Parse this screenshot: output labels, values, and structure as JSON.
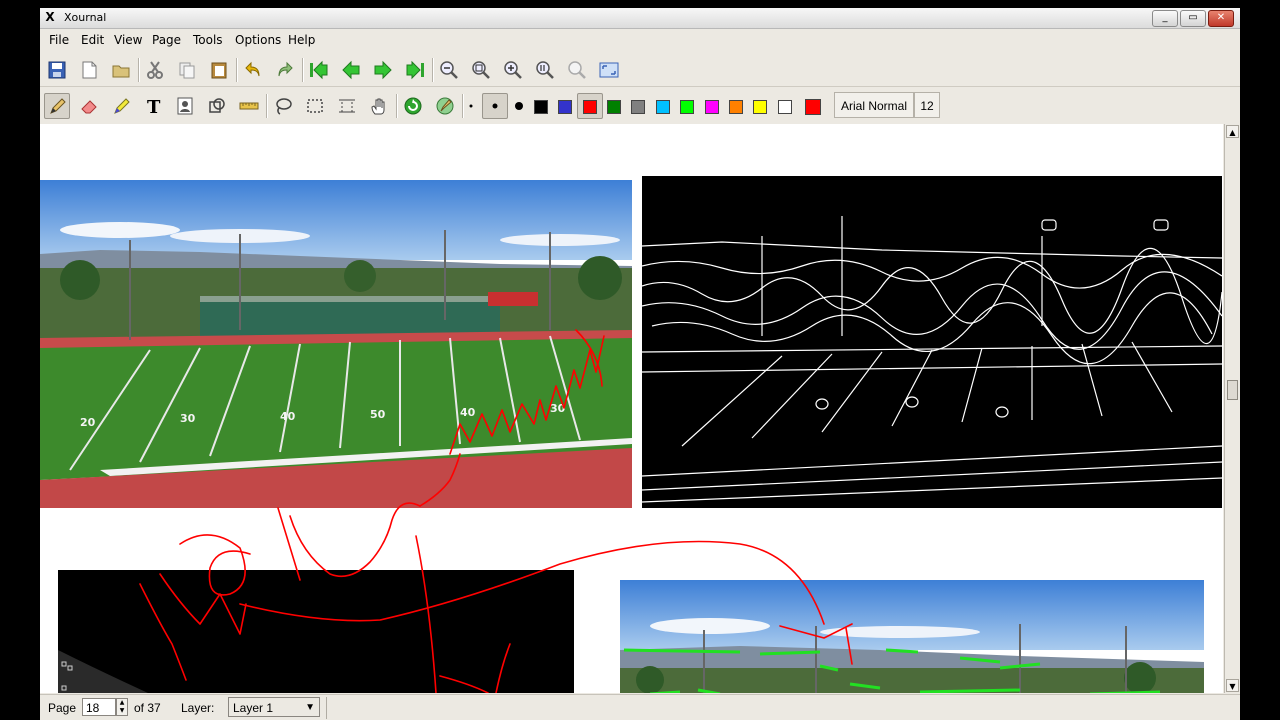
{
  "window": {
    "title": "Xournal",
    "minimize": "_",
    "maximize": "▭",
    "close": "✕"
  },
  "menu": [
    {
      "label": "File"
    },
    {
      "label": "Edit"
    },
    {
      "label": "View"
    },
    {
      "label": "Page"
    },
    {
      "label": "Tools"
    },
    {
      "label": "Options"
    },
    {
      "label": "Help"
    }
  ],
  "toolbar_main": [
    "save-icon",
    "new-page-icon",
    "open-icon",
    "cut-icon",
    "copy-icon",
    "paste-icon",
    "undo-icon",
    "redo-icon",
    "first-page-icon",
    "previous-page-icon",
    "next-page-icon",
    "last-page-icon",
    "zoom-out-icon",
    "zoom-fit-icon",
    "zoom-in-icon",
    "zoom-100-icon",
    "zoom-set-icon",
    "fullscreen-icon"
  ],
  "toolbar_tools": {
    "active_tool": "pen",
    "active_thickness": "medium",
    "active_color": "#ff0000",
    "colors": [
      "#000000",
      "#3333cc",
      "#ff0000",
      "#008000",
      "#808080",
      "#00c0ff",
      "#00ff00",
      "#ff00ff",
      "#ff8000",
      "#ffff00",
      "#ffffff"
    ],
    "current_color": "#ff0000",
    "font_name": "Arial Normal",
    "font_size": "12"
  },
  "statusbar": {
    "page_label": "Page",
    "page_value": "18",
    "page_of": "of 37",
    "layer_label": "Layer:",
    "layer_value": "Layer 1"
  }
}
